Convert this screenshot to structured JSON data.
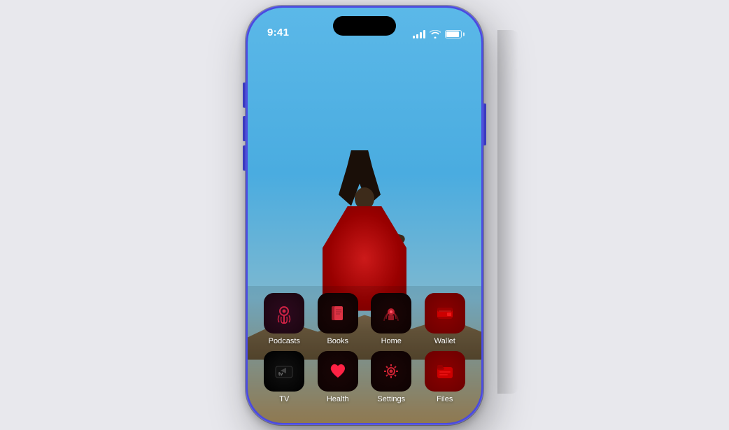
{
  "phone": {
    "status_bar": {
      "time": "9:41",
      "signal_label": "signal",
      "wifi_label": "wifi",
      "battery_label": "battery"
    },
    "apps": {
      "row1": [
        {
          "id": "podcasts",
          "label": "Podcasts",
          "icon_type": "podcasts"
        },
        {
          "id": "books",
          "label": "Books",
          "icon_type": "books"
        },
        {
          "id": "home",
          "label": "Home",
          "icon_type": "home"
        },
        {
          "id": "wallet",
          "label": "Wallet",
          "icon_type": "wallet"
        }
      ],
      "row2": [
        {
          "id": "tv",
          "label": "TV",
          "icon_type": "tv"
        },
        {
          "id": "health",
          "label": "Health",
          "icon_type": "health"
        },
        {
          "id": "settings",
          "label": "Settings",
          "icon_type": "settings"
        },
        {
          "id": "files",
          "label": "Files",
          "icon_type": "files"
        }
      ]
    }
  }
}
